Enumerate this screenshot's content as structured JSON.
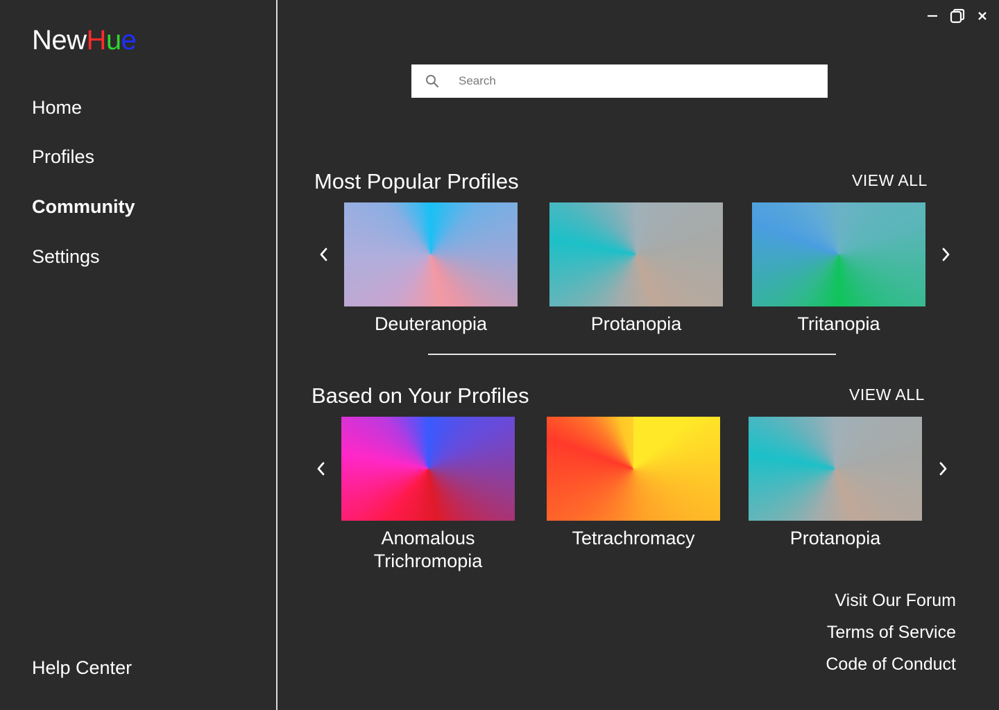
{
  "app": {
    "logo": {
      "part_new": "New",
      "part_h": "H",
      "part_u": "u",
      "part_e": "e"
    },
    "colors": {
      "background": "#2b2b2b",
      "logo_h": "#ff2a2a",
      "logo_u": "#2fd62f",
      "logo_e": "#1f2fff"
    }
  },
  "sidebar": {
    "items": [
      {
        "label": "Home",
        "active": false
      },
      {
        "label": "Profiles",
        "active": false
      },
      {
        "label": "Community",
        "active": true
      },
      {
        "label": "Settings",
        "active": false
      }
    ],
    "help": "Help Center"
  },
  "window_controls": {
    "minimize_icon": "minimize-icon",
    "restore_icon": "restore-icon",
    "close_icon": "close-icon"
  },
  "search": {
    "placeholder": "Search",
    "value": "",
    "icon": "search-icon"
  },
  "popular": {
    "title": "Most Popular Profiles",
    "view_all": "VIEW ALL",
    "prev_icon": "chevron-left-icon",
    "next_icon": "chevron-right-icon",
    "cards": [
      {
        "label": "Deuteranopia",
        "gradient": "g-deuter"
      },
      {
        "label": "Protanopia",
        "gradient": "g-prot"
      },
      {
        "label": "Tritanopia",
        "gradient": "g-trit"
      }
    ]
  },
  "based": {
    "title": "Based on Your Profiles",
    "view_all": "VIEW ALL",
    "prev_icon": "chevron-left-icon",
    "next_icon": "chevron-right-icon",
    "cards": [
      {
        "label_line1": "Anomalous",
        "label_line2": "Trichromopia",
        "gradient": "g-anom"
      },
      {
        "label": "Tetrachromacy",
        "gradient": "g-tetra"
      },
      {
        "label": "Protanopia",
        "gradient": "g-prot"
      }
    ]
  },
  "footer": {
    "forum": "Visit Our Forum",
    "terms": "Terms of Service",
    "code": "Code of Conduct"
  }
}
